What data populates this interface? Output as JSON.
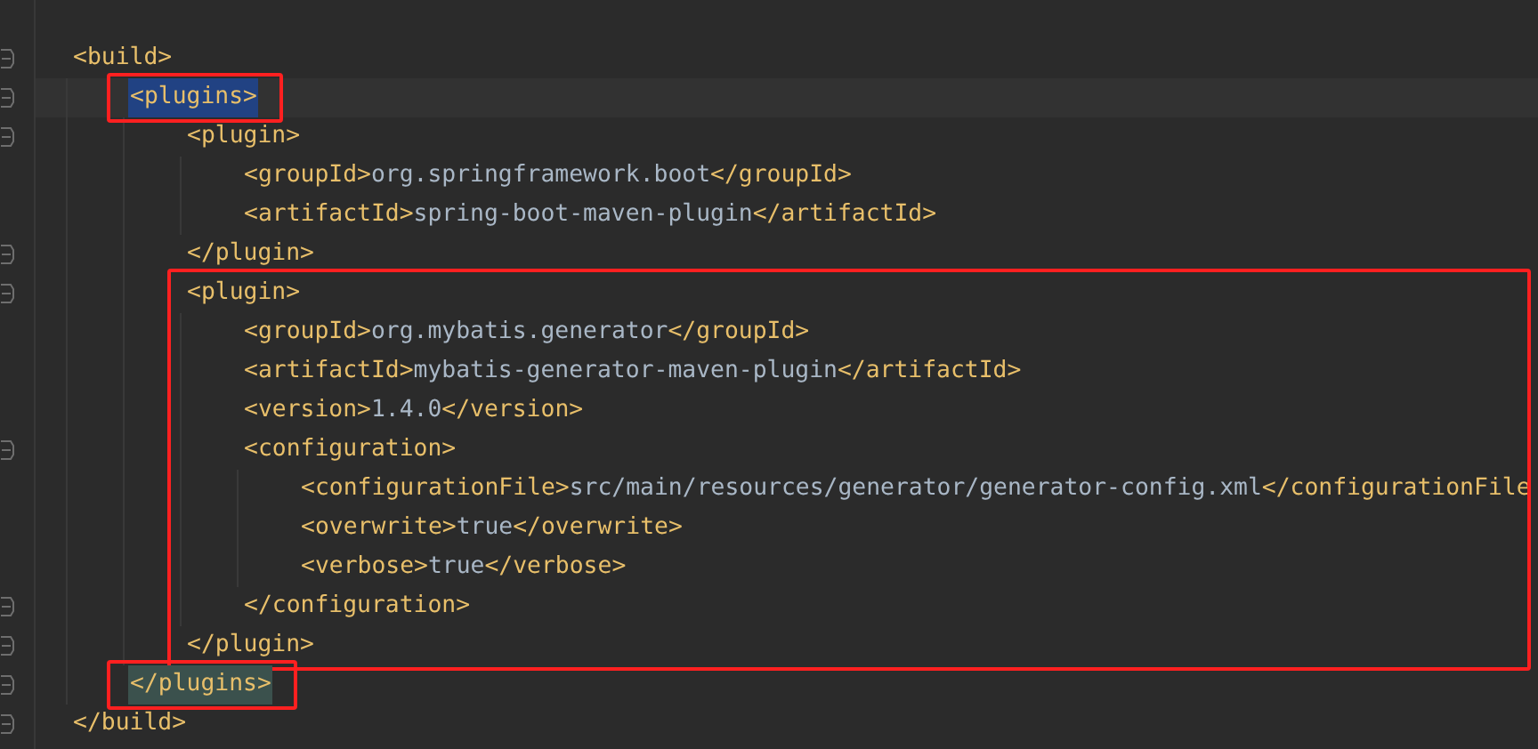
{
  "editor": {
    "root": {
      "open": {
        "segments": [
          {
            "kind": "tag",
            "text": "<build>"
          }
        ]
      },
      "close": {
        "segments": [
          {
            "kind": "tag",
            "text": "</build>"
          }
        ]
      },
      "children": [
        {
          "open": {
            "segments": [
              {
                "kind": "tag",
                "text": "<plugins>"
              }
            ],
            "current": true,
            "selected": true,
            "boxed": true
          },
          "close": {
            "segments": [
              {
                "kind": "tag",
                "text": "</plugins>"
              }
            ],
            "matched": true,
            "boxed": true
          },
          "children": [
            {
              "open": {
                "segments": [
                  {
                    "kind": "tag",
                    "text": "<plugin>"
                  }
                ]
              },
              "close": {
                "segments": [
                  {
                    "kind": "tag",
                    "text": "</plugin>"
                  }
                ]
              },
              "children": [
                {
                  "line": {
                    "segments": [
                      {
                        "kind": "tag",
                        "text": "<groupId>"
                      },
                      {
                        "kind": "value",
                        "text": "org.springframework.boot"
                      },
                      {
                        "kind": "tag",
                        "text": "</groupId>"
                      }
                    ]
                  }
                },
                {
                  "line": {
                    "segments": [
                      {
                        "kind": "tag",
                        "text": "<artifactId>"
                      },
                      {
                        "kind": "value",
                        "text": "spring-boot-maven-plugin"
                      },
                      {
                        "kind": "tag",
                        "text": "</artifactId>"
                      }
                    ]
                  }
                }
              ]
            },
            {
              "boxed": true,
              "open": {
                "segments": [
                  {
                    "kind": "tag",
                    "text": "<plugin>"
                  }
                ]
              },
              "close": {
                "segments": [
                  {
                    "kind": "tag",
                    "text": "</plugin>"
                  }
                ]
              },
              "children": [
                {
                  "line": {
                    "segments": [
                      {
                        "kind": "tag",
                        "text": "<groupId>"
                      },
                      {
                        "kind": "value",
                        "text": "org.mybatis.generator"
                      },
                      {
                        "kind": "tag",
                        "text": "</groupId>"
                      }
                    ]
                  }
                },
                {
                  "line": {
                    "segments": [
                      {
                        "kind": "tag",
                        "text": "<artifactId>"
                      },
                      {
                        "kind": "value",
                        "text": "mybatis-generator-maven-plugin"
                      },
                      {
                        "kind": "tag",
                        "text": "</artifactId>"
                      }
                    ]
                  }
                },
                {
                  "line": {
                    "segments": [
                      {
                        "kind": "tag",
                        "text": "<version>"
                      },
                      {
                        "kind": "value",
                        "text": "1.4.0"
                      },
                      {
                        "kind": "tag",
                        "text": "</version>"
                      }
                    ]
                  }
                },
                {
                  "open": {
                    "segments": [
                      {
                        "kind": "tag",
                        "text": "<configuration>"
                      }
                    ]
                  },
                  "close": {
                    "segments": [
                      {
                        "kind": "tag",
                        "text": "</configuration>"
                      }
                    ]
                  },
                  "children": [
                    {
                      "line": {
                        "segments": [
                          {
                            "kind": "tag",
                            "text": "<configurationFile>"
                          },
                          {
                            "kind": "value",
                            "text": "src/main/resources/generator/generator-config.xml"
                          },
                          {
                            "kind": "tag",
                            "text": "</configurationFile"
                          }
                        ]
                      }
                    },
                    {
                      "line": {
                        "segments": [
                          {
                            "kind": "tag",
                            "text": "<overwrite>"
                          },
                          {
                            "kind": "value",
                            "text": "true"
                          },
                          {
                            "kind": "tag",
                            "text": "</overwrite>"
                          }
                        ]
                      }
                    },
                    {
                      "line": {
                        "segments": [
                          {
                            "kind": "tag",
                            "text": "<verbose>"
                          },
                          {
                            "kind": "value",
                            "text": "true"
                          },
                          {
                            "kind": "tag",
                            "text": "</verbose>"
                          }
                        ]
                      }
                    }
                  ]
                }
              ]
            }
          ]
        }
      ]
    }
  }
}
